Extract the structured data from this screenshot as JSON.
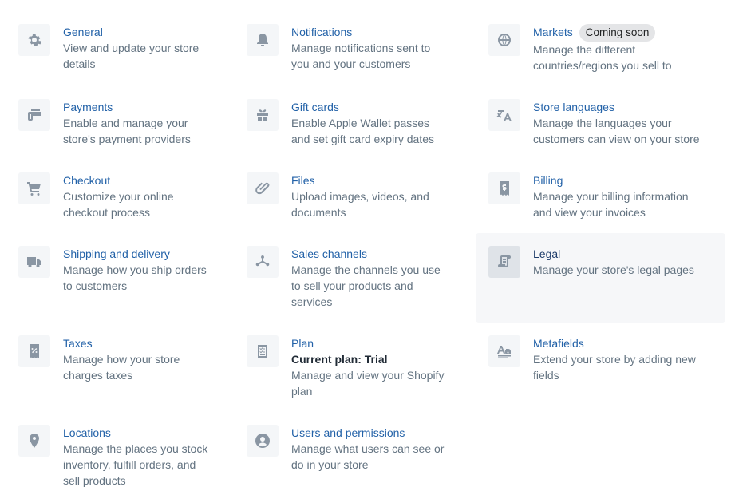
{
  "settings": [
    {
      "title": "General",
      "description": "View and update your store details",
      "icon": "gear-icon"
    },
    {
      "title": "Notifications",
      "description": "Manage notifications sent to you and your customers",
      "icon": "bell-icon"
    },
    {
      "title": "Markets",
      "badge": "Coming soon",
      "description": "Manage the different countries/regions you sell to",
      "icon": "globe-icon"
    },
    {
      "title": "Payments",
      "description": "Enable and manage your store's payment providers",
      "icon": "payment-card-icon"
    },
    {
      "title": "Gift cards",
      "description": "Enable Apple Wallet passes and set gift card expiry dates",
      "icon": "gift-icon"
    },
    {
      "title": "Store languages",
      "description": "Manage the languages your customers can view on your store",
      "icon": "translate-icon"
    },
    {
      "title": "Checkout",
      "description": "Customize your online checkout process",
      "icon": "cart-icon"
    },
    {
      "title": "Files",
      "description": "Upload images, videos, and documents",
      "icon": "paperclip-icon"
    },
    {
      "title": "Billing",
      "description": "Manage your billing information and view your invoices",
      "icon": "bill-icon"
    },
    {
      "title": "Shipping and delivery",
      "description": "Manage how you ship orders to customers",
      "icon": "truck-icon"
    },
    {
      "title": "Sales channels",
      "description": "Manage the channels you use to sell your products and services",
      "icon": "channels-icon"
    },
    {
      "title": "Legal",
      "description": "Manage your store's legal pages",
      "icon": "scroll-icon",
      "active": true
    },
    {
      "title": "Taxes",
      "description": "Manage how your store charges taxes",
      "icon": "tax-receipt-icon"
    },
    {
      "title": "Plan",
      "subtitle": "Current plan: Trial",
      "description": "Manage and view your Shopify plan",
      "icon": "checklist-icon"
    },
    {
      "title": "Metafields",
      "description": "Extend your store by adding new fields",
      "icon": "text-format-icon"
    },
    {
      "title": "Locations",
      "description": "Manage the places you stock inventory, fulfill orders, and sell products",
      "icon": "location-pin-icon"
    },
    {
      "title": "Users and permissions",
      "description": "Manage what users can see or do in your store",
      "icon": "user-icon"
    }
  ]
}
